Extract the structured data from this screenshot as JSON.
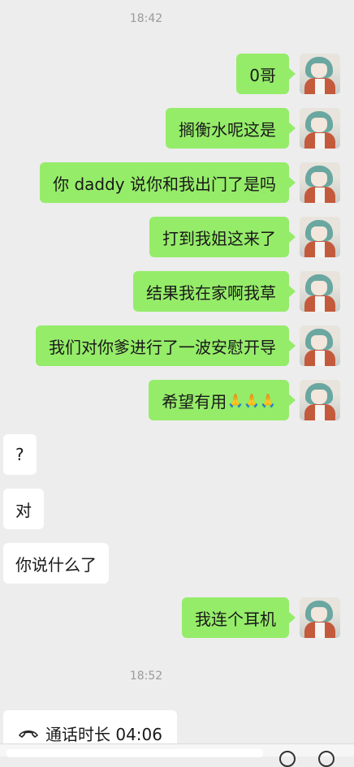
{
  "timestamps": [
    "18:42",
    "18:52"
  ],
  "messages": [
    {
      "side": "right",
      "text": "0哥"
    },
    {
      "side": "right",
      "text": "搁衡水呢这是"
    },
    {
      "side": "right",
      "text": "你 daddy 说你和我出门了是吗"
    },
    {
      "side": "right",
      "text": "打到我姐这来了"
    },
    {
      "side": "right",
      "text": "结果我在家啊我草"
    },
    {
      "side": "right",
      "text": "我们对你爹进行了一波安慰开导"
    },
    {
      "side": "right",
      "text": "希望有用",
      "emoji": "🙏🙏🙏"
    },
    {
      "side": "left",
      "text": "?"
    },
    {
      "side": "left",
      "text": "对"
    },
    {
      "side": "left",
      "text": "你说什么了"
    },
    {
      "side": "right",
      "text": "我连个耳机"
    }
  ],
  "call": {
    "icon": "phone-hangup-icon",
    "label": "通话时长 04:06"
  },
  "colors": {
    "background": "#ededed",
    "sent_bubble": "#95ec69",
    "received_bubble": "#ffffff",
    "timestamp": "#9a9a9a"
  }
}
